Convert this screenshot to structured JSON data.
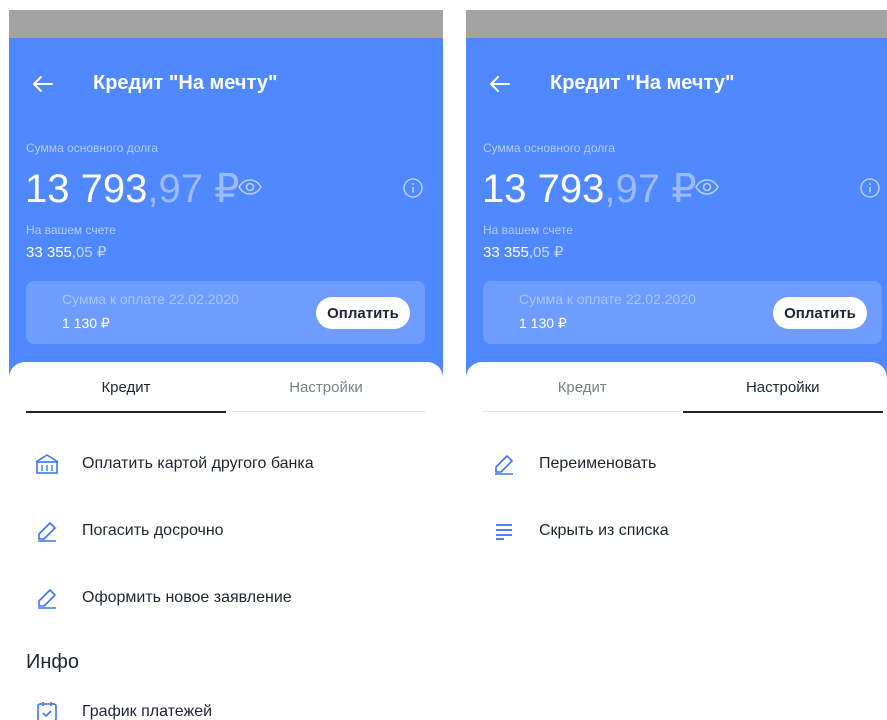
{
  "screens": [
    {
      "title": "Кредит \"На мечту\"",
      "debt_label": "Сумма основного долга",
      "amount_int": "13 793",
      "amount_dec": ",97",
      "amount_currency": " ₽",
      "account_label": "На вашем счете",
      "account_int": "33 355",
      "account_dec": ",05 ₽",
      "pay_label": "Сумма к оплате 22.02.2020",
      "pay_amount": "1 130 ₽",
      "pay_button": "Оплатить",
      "tabs": [
        "Кредит",
        "Настройки"
      ],
      "active_tab": 0,
      "items": [
        {
          "label": "Оплатить картой другого банка",
          "icon": "bank-icon"
        },
        {
          "label": "Погасить досрочно",
          "icon": "pencil-icon"
        },
        {
          "label": "Оформить новое заявление",
          "icon": "pencil-icon"
        }
      ],
      "section_title": "Инфо",
      "info_items": [
        {
          "label": "График платежей",
          "icon": "calendar-check-icon"
        }
      ]
    },
    {
      "title": "Кредит \"На мечту\"",
      "debt_label": "Сумма основного долга",
      "amount_int": "13 793",
      "amount_dec": ",97",
      "amount_currency": " ₽",
      "account_label": "На вашем счете",
      "account_int": "33 355",
      "account_dec": ",05 ₽",
      "pay_label": "Сумма к оплате 22.02.2020",
      "pay_amount": "1 130 ₽",
      "pay_button": "Оплатить",
      "tabs": [
        "Кредит",
        "Настройки"
      ],
      "active_tab": 1,
      "items": [
        {
          "label": "Переименовать",
          "icon": "pencil-icon"
        },
        {
          "label": "Скрыть из списка",
          "icon": "list-icon"
        }
      ]
    }
  ],
  "colors": {
    "hero_blue": "#4f88ff",
    "card_blue": "#6e9dff",
    "icon_blue": "#3a74f5"
  }
}
